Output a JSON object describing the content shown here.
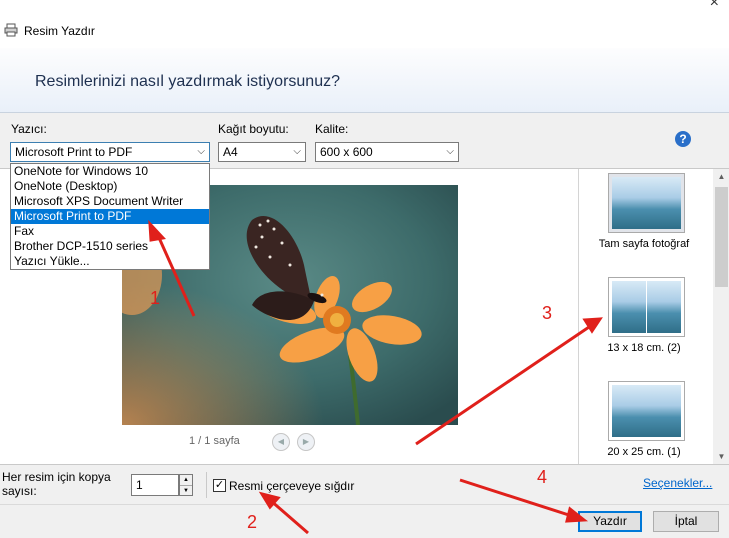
{
  "window": {
    "title": "Resim Yazdır",
    "close_glyph": "×"
  },
  "header": {
    "question": "Resimlerinizi nasıl yazdırmak istiyorsunuz?"
  },
  "printer": {
    "label": "Yazıcı:",
    "selected": "Microsoft Print to PDF",
    "options": [
      "OneNote for Windows 10",
      "OneNote (Desktop)",
      "Microsoft XPS Document Writer",
      "Microsoft Print to PDF",
      "Fax",
      "Brother DCP-1510 series",
      "Yazıcı Yükle..."
    ],
    "highlighted_index": 3
  },
  "paper": {
    "label": "Kağıt boyutu:",
    "selected": "A4"
  },
  "quality": {
    "label": "Kalite:",
    "selected": "600 x 600"
  },
  "help": {
    "glyph": "?"
  },
  "preview": {
    "pager": "1 / 1 sayfa"
  },
  "layouts": [
    {
      "label": "Tam sayfa fotoğraf",
      "selected": true
    },
    {
      "label": "13 x 18 cm. (2)",
      "selected": false
    },
    {
      "label": "20 x 25 cm. (1)",
      "selected": false
    }
  ],
  "copies": {
    "label_line1": "Her resim için kopya",
    "label_line2": "sayısı:",
    "value": "1"
  },
  "fit": {
    "label": "Resmi çerçeveye sığdır",
    "checked": true
  },
  "options_link": "Seçenekler...",
  "buttons": {
    "print": "Yazdır",
    "cancel": "İptal"
  },
  "annotations": [
    "1",
    "2",
    "3",
    "4"
  ],
  "colors": {
    "accent": "#0078d7",
    "annotation": "#e0201b"
  }
}
